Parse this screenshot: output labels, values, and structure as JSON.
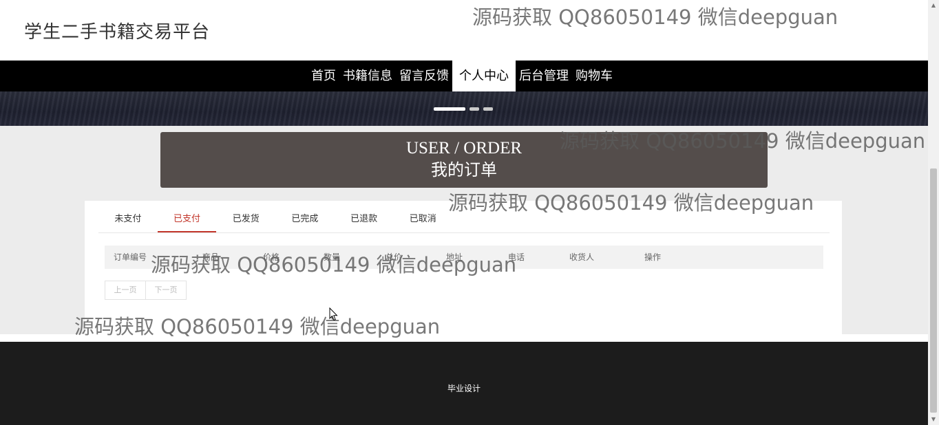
{
  "header": {
    "site_title": "学生二手书籍交易平台"
  },
  "nav": {
    "items": [
      "首页",
      "书籍信息",
      "留言反馈",
      "个人中心",
      "后台管理",
      "购物车"
    ],
    "active_label": "个人中心"
  },
  "carousel": {
    "slide_count": 3,
    "active_index": 0
  },
  "order_title": {
    "en": "USER / ORDER",
    "cn": "我的订单"
  },
  "tabs": [
    "未支付",
    "已支付",
    "已发货",
    "已完成",
    "已退款",
    "已取消"
  ],
  "active_tab": "已支付",
  "table": {
    "columns": [
      "订单编号",
      "商品",
      "价格",
      "数量",
      "总价",
      "地址",
      "电话",
      "收货人",
      "操作"
    ],
    "rows": []
  },
  "pager": {
    "prev_label": "上一页",
    "next_label": "下一页"
  },
  "footer": {
    "text": "毕业设计"
  },
  "watermark": {
    "text": "源码获取 QQ86050149 微信deepguan"
  },
  "colors": {
    "nav_bg": "#000000",
    "accent": "#c2352a",
    "title_box": "#544d4b",
    "footer_bg": "#1c1c1c"
  }
}
